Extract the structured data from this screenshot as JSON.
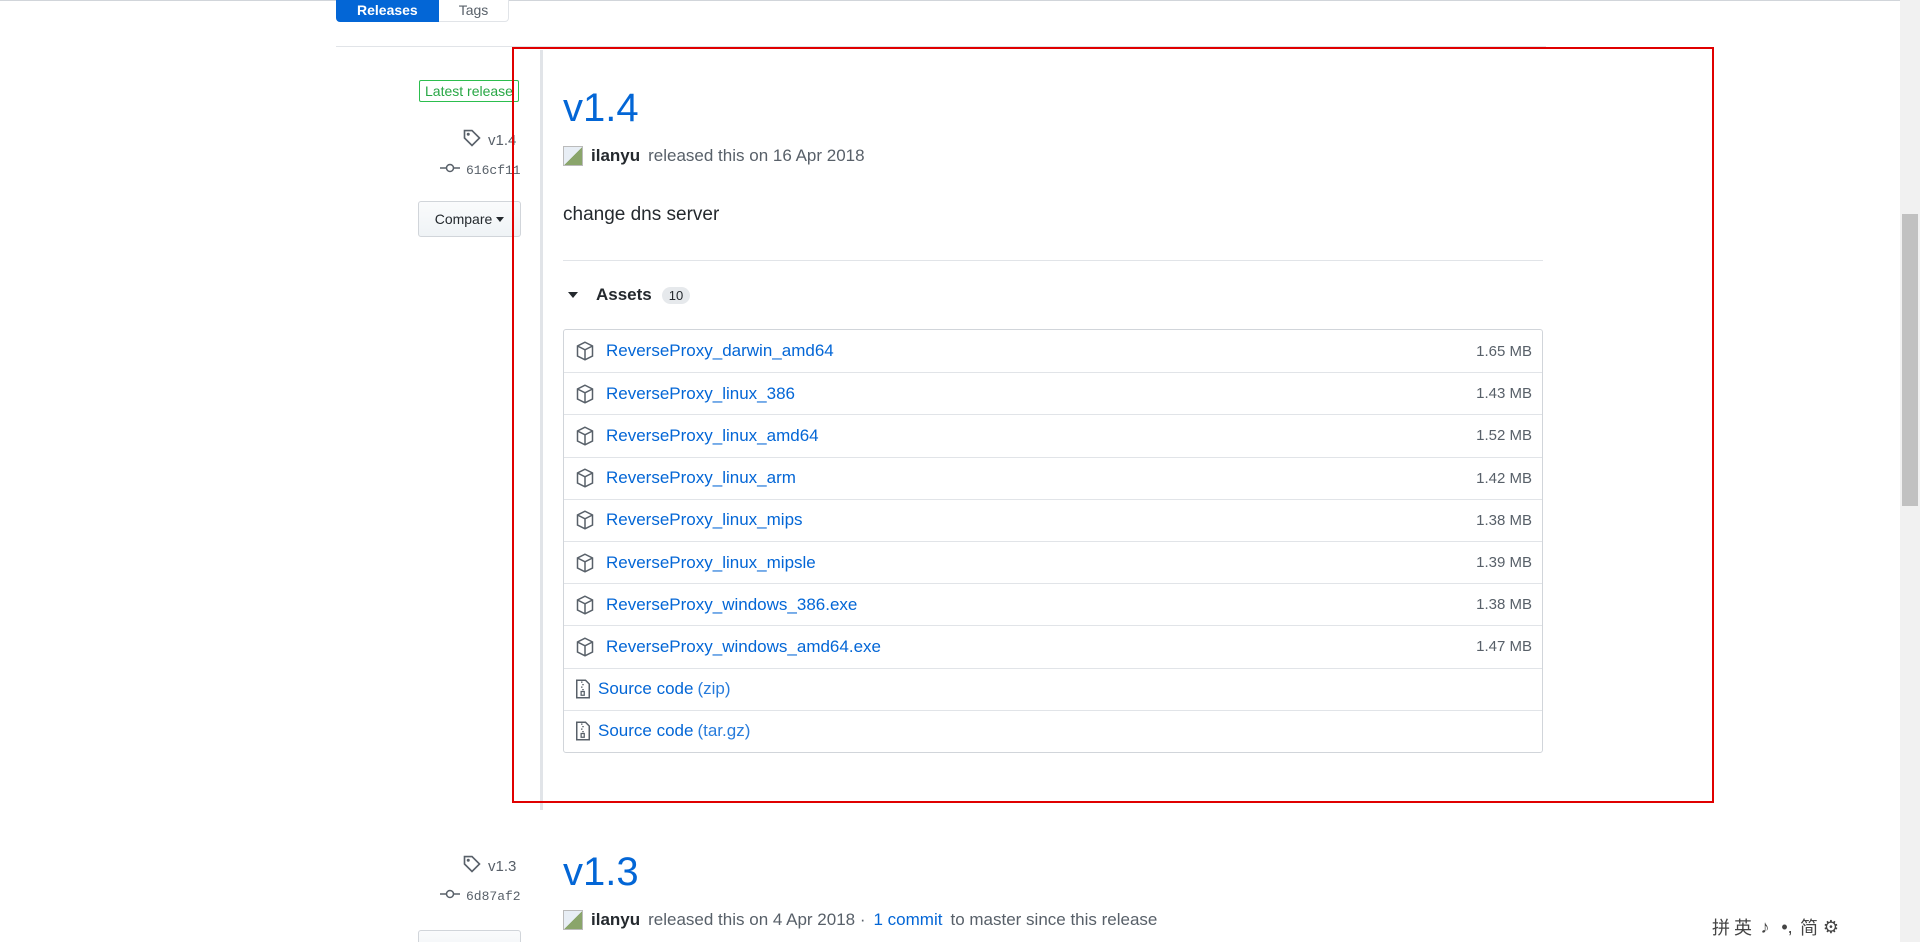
{
  "subnav": {
    "tabs": [
      {
        "label": "Releases"
      },
      {
        "label": "Tags"
      }
    ]
  },
  "sidebar": {
    "latest_badge": "Latest release",
    "tag": "v1.4",
    "commit": "616cf11",
    "compare_label": "Compare"
  },
  "release": {
    "title": "v1.4",
    "author": "ilanyu",
    "released_text": "released this on 16 Apr 2018",
    "body": "change dns server",
    "assets_label": "Assets",
    "assets_count": "10",
    "assets": [
      {
        "name": "ReverseProxy_darwin_amd64",
        "size": "1.65 MB"
      },
      {
        "name": "ReverseProxy_linux_386",
        "size": "1.43 MB"
      },
      {
        "name": "ReverseProxy_linux_amd64",
        "size": "1.52 MB"
      },
      {
        "name": "ReverseProxy_linux_arm",
        "size": "1.42 MB"
      },
      {
        "name": "ReverseProxy_linux_mips",
        "size": "1.38 MB"
      },
      {
        "name": "ReverseProxy_linux_mipsle",
        "size": "1.39 MB"
      },
      {
        "name": "ReverseProxy_windows_386.exe",
        "size": "1.38 MB"
      },
      {
        "name": "ReverseProxy_windows_amd64.exe",
        "size": "1.47 MB"
      }
    ],
    "source": [
      {
        "name": "Source code",
        "ext": "(zip)"
      },
      {
        "name": "Source code",
        "ext": "(tar.gz)"
      }
    ]
  },
  "release2": {
    "tag": "v1.3",
    "commit": "6d87af2",
    "title": "v1.3",
    "author": "ilanyu",
    "released_text": "released this on 4 Apr 2018 ·",
    "commits_link": "1 commit",
    "since_text": "to master since this release"
  },
  "ime": {
    "items": [
      "拼",
      "英",
      "♪",
      "•,",
      "简",
      "⚙"
    ]
  }
}
